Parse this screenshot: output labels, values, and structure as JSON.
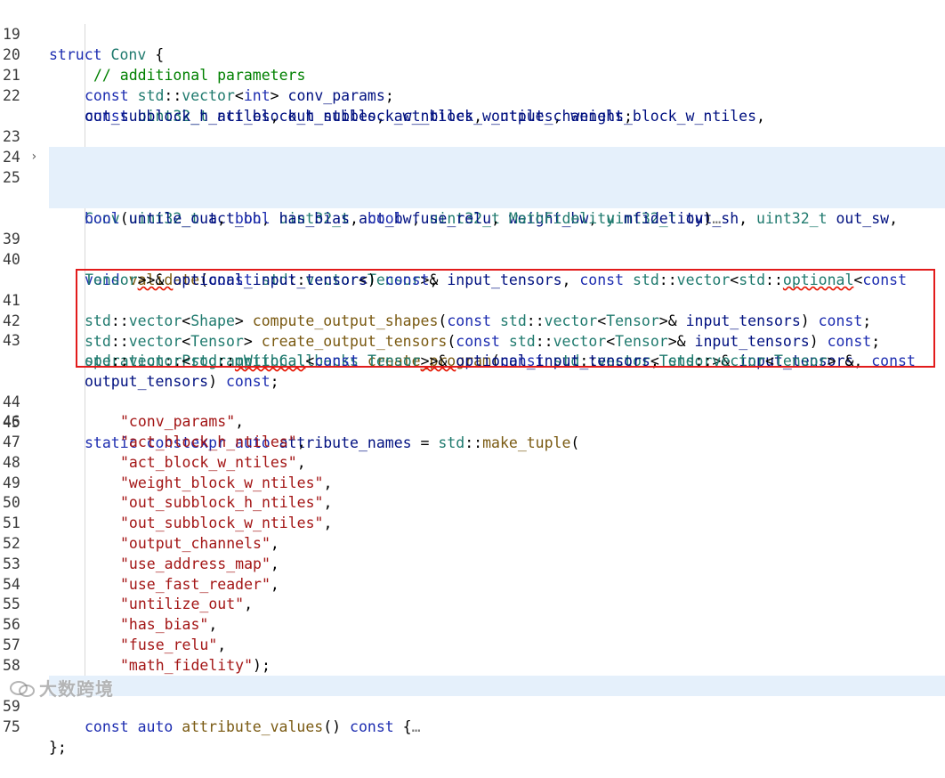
{
  "editor": {
    "language": "cpp",
    "colors": {
      "keyword": "#1c2cb0",
      "type": "#1f7a6e",
      "function": "#7a5a12",
      "string": "#a31515",
      "comment": "#008000",
      "highlight_box": "#e21b1b",
      "folded_line_bg": "#e5f0fb"
    },
    "lines": [
      {
        "ln": "19",
        "tokens": [
          [
            "kw",
            "struct "
          ],
          [
            "ty",
            "Conv"
          ],
          [
            "pu",
            " {"
          ]
        ]
      },
      {
        "ln": "20",
        "tokens": [
          [
            "cm",
            "// additional parameters"
          ]
        ]
      },
      {
        "ln": "21",
        "tokens": [
          [
            "kw",
            "const "
          ],
          [
            "ty",
            "std"
          ],
          [
            "pu",
            "::"
          ],
          [
            "ty",
            "vector"
          ],
          [
            "pu",
            "<"
          ],
          [
            "kw",
            "int"
          ],
          [
            "pu",
            "> "
          ],
          [
            "par",
            "conv_params"
          ],
          [
            "pu",
            ";"
          ]
        ]
      },
      {
        "ln": "22",
        "tokens": [
          [
            "kw",
            "const "
          ],
          [
            "ty",
            "uint32_t "
          ],
          [
            "par",
            "act_block_h_ntiles"
          ],
          [
            "pu",
            ", "
          ],
          [
            "par",
            "act_block_w_ntiles"
          ],
          [
            "pu",
            ", "
          ],
          [
            "par",
            "weight_block_w_ntiles"
          ],
          [
            "pu",
            ","
          ]
        ]
      },
      {
        "ln": "",
        "tokens": [
          [
            "par",
            "out_subblock_h_ntiles"
          ],
          [
            "pu",
            ", "
          ],
          [
            "par",
            "out_subblock_w_ntiles"
          ],
          [
            "pu",
            ", "
          ],
          [
            "par",
            "output_channels"
          ],
          [
            "pu",
            ";"
          ]
        ]
      },
      {
        "ln": "23",
        "tokens": [
          [
            "kw",
            "bool "
          ],
          [
            "par",
            "use_address_map"
          ],
          [
            "pu",
            ", "
          ],
          [
            "par",
            "use_fast_reader"
          ],
          [
            "pu",
            ", "
          ],
          [
            "par",
            "untilize_out"
          ],
          [
            "pu",
            ", "
          ],
          [
            "par",
            "has_bias"
          ],
          [
            "pu",
            ", "
          ],
          [
            "par",
            "fuse_relu"
          ],
          [
            "pu",
            ";"
          ]
        ]
      },
      {
        "ln": "24",
        "tokens": [
          [
            "ty",
            "MathFidelity "
          ],
          [
            "par",
            "math_fidelity"
          ],
          [
            "pu",
            ";"
          ]
        ]
      },
      {
        "ln": "25",
        "fold": "›",
        "tokens": [
          [
            "ty",
            "Conv"
          ],
          [
            "pu",
            "("
          ],
          [
            "ty",
            "uint32_t "
          ],
          [
            "par",
            "act_bh"
          ],
          [
            "pu",
            ", "
          ],
          [
            "ty",
            "uint32_t "
          ],
          [
            "par",
            "act_bw"
          ],
          [
            "pu",
            ", "
          ],
          [
            "ty",
            "uint32_t "
          ],
          [
            "par",
            "weight_bw"
          ],
          [
            "pu",
            ", "
          ],
          [
            "ty",
            "uint32_t "
          ],
          [
            "par",
            "out_sh"
          ],
          [
            "pu",
            ", "
          ],
          [
            "ty",
            "uint32_t "
          ],
          [
            "par",
            "out_sw"
          ],
          [
            "pu",
            ","
          ]
        ]
      },
      {
        "ln": "",
        "tokens": [
          [
            "kw",
            "const "
          ],
          [
            "ty",
            "std"
          ],
          [
            "pu",
            "::"
          ],
          [
            "ty",
            "vector"
          ],
          [
            "pu",
            "<"
          ],
          [
            "kw",
            "int"
          ],
          [
            "pu",
            ">&"
          ],
          [
            "par",
            "c_params"
          ],
          [
            "pu",
            ", "
          ],
          [
            "ty",
            "uint32_t "
          ],
          [
            "par",
            "output_channels"
          ],
          [
            "pu",
            ", "
          ],
          [
            "kw",
            "bool "
          ],
          [
            "par",
            "address_map"
          ],
          [
            "pu",
            ", "
          ],
          [
            "kw",
            "bool "
          ],
          [
            "par",
            "fast_reader"
          ],
          [
            "pu",
            ","
          ]
        ]
      },
      {
        "ln": "",
        "tokens": [
          [
            "kw",
            "bool "
          ],
          [
            "par",
            "untile_out"
          ],
          [
            "pu",
            ", "
          ],
          [
            "kw",
            "bool "
          ],
          [
            "par",
            "has_bias"
          ],
          [
            "pu",
            ", "
          ],
          [
            "kw",
            "bool "
          ],
          [
            "par",
            "fuse_relu"
          ],
          [
            "pu",
            ", "
          ],
          [
            "ty",
            "MathFidelity "
          ],
          [
            "par",
            "mfidelity"
          ],
          [
            "pu",
            ")"
          ],
          [
            "pu",
            "…"
          ]
        ]
      },
      {
        "ln": "39",
        "tokens": []
      },
      {
        "ln": "40",
        "tokens": [
          [
            "kw",
            "void "
          ],
          [
            "fn",
            "validate"
          ],
          [
            "pu",
            "("
          ],
          [
            "kw",
            "const "
          ],
          [
            "ty",
            "std"
          ],
          [
            "pu",
            "::"
          ],
          [
            "ty",
            "vector"
          ],
          [
            "pu",
            "<"
          ],
          [
            "ty",
            "Tensor"
          ],
          [
            "pu",
            ">& "
          ],
          [
            "par",
            "input_tensors"
          ],
          [
            "pu",
            ", "
          ],
          [
            "kw",
            "const "
          ],
          [
            "ty",
            "std"
          ],
          [
            "pu",
            "::"
          ],
          [
            "ty",
            "vector"
          ],
          [
            "pu",
            "<"
          ],
          [
            "ty",
            "std"
          ],
          [
            "pu",
            "::"
          ],
          [
            "ty",
            "optional"
          ],
          [
            "pu",
            "<"
          ],
          [
            "kw",
            "const"
          ]
        ]
      },
      {
        "ln": "",
        "tokens": [
          [
            "ty",
            "Tensor"
          ],
          [
            "pu",
            ">>& "
          ],
          [
            "par",
            "optional_input_tensors"
          ],
          [
            "pu",
            ") "
          ],
          [
            "kw",
            "const"
          ],
          [
            "pu",
            ";"
          ]
        ]
      },
      {
        "ln": "41",
        "tokens": [
          [
            "ty",
            "std"
          ],
          [
            "pu",
            "::"
          ],
          [
            "ty",
            "vector"
          ],
          [
            "pu",
            "<"
          ],
          [
            "ty",
            "Shape"
          ],
          [
            "pu",
            "> "
          ],
          [
            "fn",
            "compute_output_shapes"
          ],
          [
            "pu",
            "("
          ],
          [
            "kw",
            "const "
          ],
          [
            "ty",
            "std"
          ],
          [
            "pu",
            "::"
          ],
          [
            "ty",
            "vector"
          ],
          [
            "pu",
            "<"
          ],
          [
            "ty",
            "Tensor"
          ],
          [
            "pu",
            ">& "
          ],
          [
            "par",
            "input_tensors"
          ],
          [
            "pu",
            ") "
          ],
          [
            "kw",
            "const"
          ],
          [
            "pu",
            ";"
          ]
        ]
      },
      {
        "ln": "42",
        "tokens": [
          [
            "ty",
            "std"
          ],
          [
            "pu",
            "::"
          ],
          [
            "ty",
            "vector"
          ],
          [
            "pu",
            "<"
          ],
          [
            "ty",
            "Tensor"
          ],
          [
            "pu",
            "> "
          ],
          [
            "fn",
            "create_output_tensors"
          ],
          [
            "pu",
            "("
          ],
          [
            "kw",
            "const "
          ],
          [
            "ty",
            "std"
          ],
          [
            "pu",
            "::"
          ],
          [
            "ty",
            "vector"
          ],
          [
            "pu",
            "<"
          ],
          [
            "ty",
            "Tensor"
          ],
          [
            "pu",
            ">& "
          ],
          [
            "par",
            "input_tensors"
          ],
          [
            "pu",
            ") "
          ],
          [
            "kw",
            "const"
          ],
          [
            "pu",
            ";"
          ]
        ]
      },
      {
        "ln": "43",
        "tokens": [
          [
            "ty",
            "operation"
          ],
          [
            "pu",
            "::"
          ],
          [
            "ty",
            "ProgramWithCallbacks "
          ],
          [
            "fn",
            "create_program"
          ],
          [
            "pu",
            "("
          ],
          [
            "kw",
            "const "
          ],
          [
            "ty",
            "std"
          ],
          [
            "pu",
            "::"
          ],
          [
            "ty",
            "vector"
          ],
          [
            "pu",
            "<"
          ],
          [
            "ty",
            "Tensor"
          ],
          [
            "pu",
            ">& "
          ],
          [
            "par",
            "input_tensors"
          ],
          [
            "pu",
            ", "
          ],
          [
            "kw",
            "const"
          ]
        ]
      },
      {
        "ln": "",
        "tokens": [
          [
            "ty",
            "std"
          ],
          [
            "pu",
            "::"
          ],
          [
            "ty",
            "vector"
          ],
          [
            "pu",
            "<"
          ],
          [
            "ty",
            "std"
          ],
          [
            "pu",
            "::"
          ],
          [
            "ty",
            "optional"
          ],
          [
            "pu",
            "<"
          ],
          [
            "kw",
            "const "
          ],
          [
            "ty",
            "Tensor"
          ],
          [
            "pu",
            ">>& "
          ],
          [
            "par",
            "optional_input_tensors"
          ],
          [
            "pu",
            ", "
          ],
          [
            "ty",
            "std"
          ],
          [
            "pu",
            "::"
          ],
          [
            "ty",
            "vector"
          ],
          [
            "pu",
            "<"
          ],
          [
            "ty",
            "Tensor"
          ],
          [
            "pu",
            "> &"
          ]
        ]
      },
      {
        "ln": "",
        "tokens": [
          [
            "par",
            "output_tensors"
          ],
          [
            "pu",
            ") "
          ],
          [
            "kw",
            "const"
          ],
          [
            "pu",
            ";"
          ]
        ]
      },
      {
        "ln": "44",
        "tokens": []
      },
      {
        "ln": "45",
        "tokens": [
          [
            "kw",
            "static "
          ],
          [
            "kw",
            "constexpr "
          ],
          [
            "kw",
            "auto "
          ],
          [
            "par",
            "attribute_names"
          ],
          [
            "pu",
            " = "
          ],
          [
            "ty",
            "std"
          ],
          [
            "pu",
            "::"
          ],
          [
            "fn",
            "make_tuple"
          ],
          [
            "pu",
            "("
          ]
        ]
      },
      {
        "ln": "46",
        "tokens": [
          [
            "str",
            "\"conv_params\""
          ],
          [
            "pu",
            ","
          ]
        ]
      },
      {
        "ln": "47",
        "tokens": [
          [
            "str",
            "\"act_block_h_ntiles\""
          ],
          [
            "pu",
            ","
          ]
        ]
      },
      {
        "ln": "48",
        "tokens": [
          [
            "str",
            "\"act_block_w_ntiles\""
          ],
          [
            "pu",
            ","
          ]
        ]
      },
      {
        "ln": "49",
        "tokens": [
          [
            "str",
            "\"weight_block_w_ntiles\""
          ],
          [
            "pu",
            ","
          ]
        ]
      },
      {
        "ln": "50",
        "tokens": [
          [
            "str",
            "\"out_subblock_h_ntiles\""
          ],
          [
            "pu",
            ","
          ]
        ]
      },
      {
        "ln": "51",
        "tokens": [
          [
            "str",
            "\"out_subblock_w_ntiles\""
          ],
          [
            "pu",
            ","
          ]
        ]
      },
      {
        "ln": "52",
        "tokens": [
          [
            "str",
            "\"output_channels\""
          ],
          [
            "pu",
            ","
          ]
        ]
      },
      {
        "ln": "53",
        "tokens": [
          [
            "str",
            "\"use_address_map\""
          ],
          [
            "pu",
            ","
          ]
        ]
      },
      {
        "ln": "54",
        "tokens": [
          [
            "str",
            "\"use_fast_reader\""
          ],
          [
            "pu",
            ","
          ]
        ]
      },
      {
        "ln": "55",
        "tokens": [
          [
            "str",
            "\"untilize_out\""
          ],
          [
            "pu",
            ","
          ]
        ]
      },
      {
        "ln": "56",
        "tokens": [
          [
            "str",
            "\"has_bias\""
          ],
          [
            "pu",
            ","
          ]
        ]
      },
      {
        "ln": "57",
        "tokens": [
          [
            "str",
            "\"fuse_relu\""
          ],
          [
            "pu",
            ","
          ]
        ]
      },
      {
        "ln": "58",
        "tokens": [
          [
            "str",
            "\"math_fidelity\""
          ],
          [
            "pu",
            ");"
          ]
        ]
      },
      {
        "ln": "59",
        "tokens": [
          [
            "kw",
            "const "
          ],
          [
            "kw",
            "auto "
          ],
          [
            "fn",
            "attribute_values"
          ],
          [
            "pu",
            "() "
          ],
          [
            "kw",
            "const "
          ],
          [
            "pu",
            "{"
          ],
          [
            "pu",
            "…"
          ]
        ]
      },
      {
        "ln": "75",
        "tokens": [
          [
            "pu",
            "};"
          ]
        ]
      }
    ]
  },
  "watermark": {
    "text": "大数跨境"
  }
}
